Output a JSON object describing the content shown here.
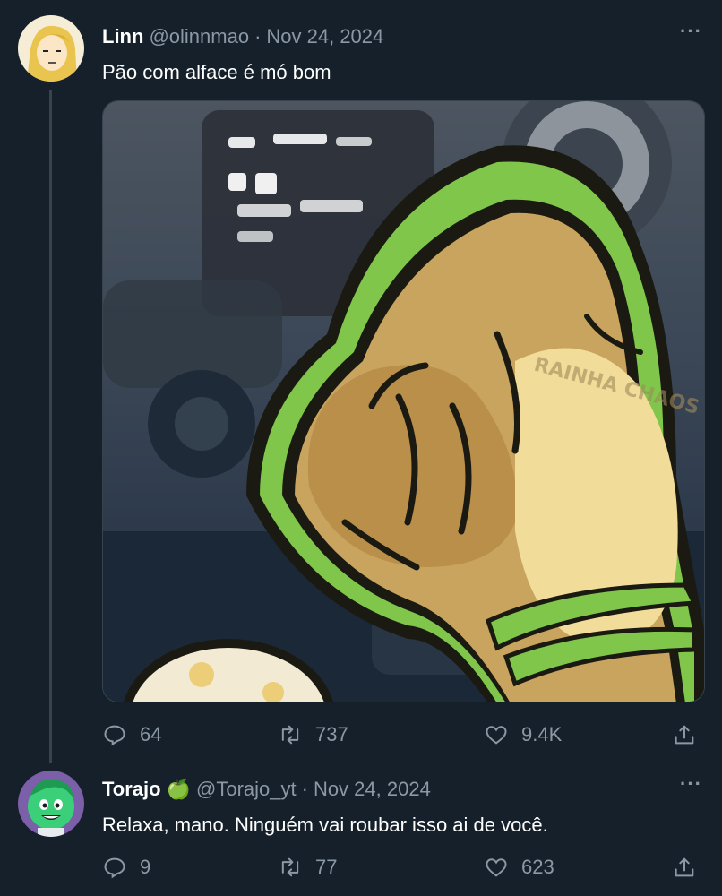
{
  "tweets": [
    {
      "name": "Linn",
      "handle": "@olinnmao",
      "separator": "·",
      "date": "Nov 24, 2024",
      "text": "Pão com alface é mó bom",
      "media_watermark": "RAINHA CHAOS",
      "actions": {
        "replies": "64",
        "retweets": "737",
        "likes": "9.4K"
      }
    },
    {
      "name": "Torajo",
      "name_emoji": "🍏",
      "handle": "@Torajo_yt",
      "separator": "·",
      "date": "Nov 24, 2024",
      "text": "Relaxa, mano. Ninguém vai roubar isso ai de você.",
      "actions": {
        "replies": "9",
        "retweets": "77",
        "likes": "623"
      }
    }
  ],
  "icons": {
    "more": "···",
    "reply": "reply-icon",
    "retweet": "retweet-icon",
    "like": "heart-icon",
    "share": "share-icon"
  },
  "colors": {
    "background": "#15202b",
    "secondary_text": "#8b98a5",
    "accent_green": "#6abf3c"
  }
}
